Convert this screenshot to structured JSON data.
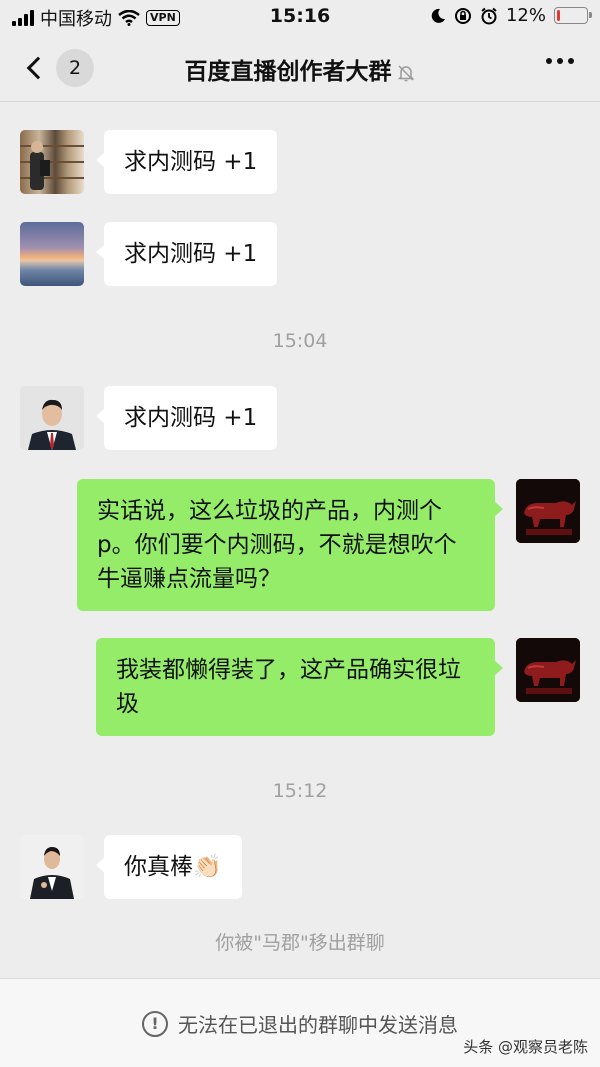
{
  "status_bar": {
    "carrier": "中国移动",
    "vpn": "VPN",
    "time": "15:16",
    "battery": "12%",
    "battery_level": 0.12,
    "battery_color": "#e53935"
  },
  "nav": {
    "unread_count": "2",
    "title": "百度直播创作者大群",
    "icons": [
      "back-chevron-icon",
      "bell-muted-icon",
      "more-icon"
    ]
  },
  "messages": [
    {
      "text": "求内测码 +1"
    },
    {
      "text": "求内测码 +1"
    },
    {
      "timestamp": "15:04"
    },
    {
      "text": "求内测码 +1"
    },
    {
      "text": "实话说，这么垃圾的产品，内测个 p。你们要个内测码，不就是想吹个牛逼赚点流量吗？"
    },
    {
      "text": "我装都懒得装了，这产品确实很垃圾"
    },
    {
      "timestamp": "15:12"
    },
    {
      "text": "你真棒👏🏻"
    },
    {
      "system": "你被\"马郡\"移出群聊"
    }
  ],
  "footer": {
    "note": "无法在已退出的群聊中发送消息",
    "watermark": "头条 @观察员老陈"
  },
  "colors": {
    "background": "#ededed",
    "outgoing_bubble": "#95ec69",
    "incoming_bubble": "#ffffff"
  }
}
